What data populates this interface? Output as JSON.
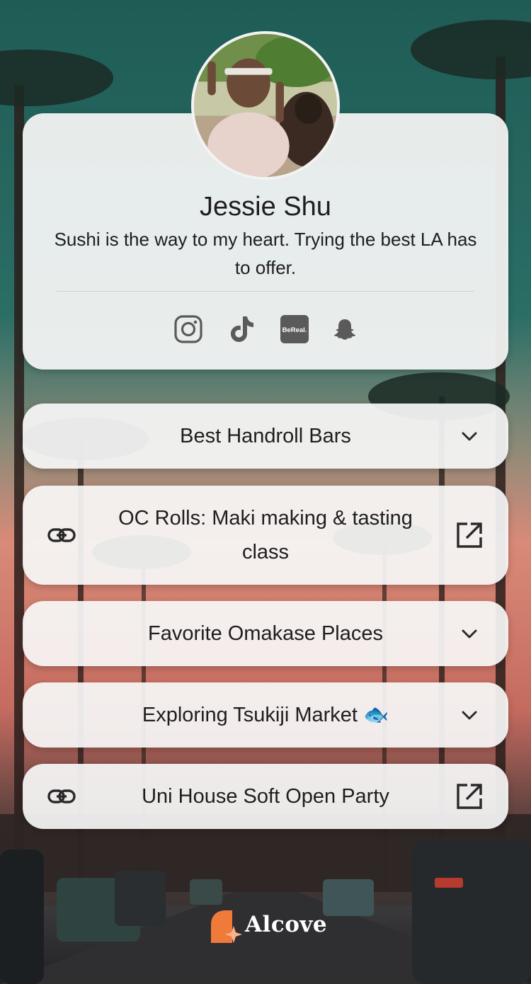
{
  "profile": {
    "name": "Jessie Shu",
    "bio": "Sushi is the way to my heart. Trying the best LA has to offer."
  },
  "socials": [
    {
      "icon": "instagram-icon"
    },
    {
      "icon": "tiktok-icon"
    },
    {
      "icon": "bereal-icon",
      "label": "BeReal."
    },
    {
      "icon": "snapchat-icon"
    }
  ],
  "links": [
    {
      "label": "Best Handroll Bars",
      "type": "expand"
    },
    {
      "label": "OC Rolls: Maki making & tasting class",
      "type": "external"
    },
    {
      "label": "Favorite Omakase Places",
      "type": "expand"
    },
    {
      "label": "Exploring Tsukiji Market 🐟",
      "type": "expand"
    },
    {
      "label": "Uni House Soft Open Party",
      "type": "external"
    }
  ],
  "brand": {
    "name": "Alcove",
    "accent": "#f07a3a"
  },
  "colors": {
    "card": "#f6f6f6",
    "text": "#1e1e1e",
    "icon": "#555555"
  }
}
